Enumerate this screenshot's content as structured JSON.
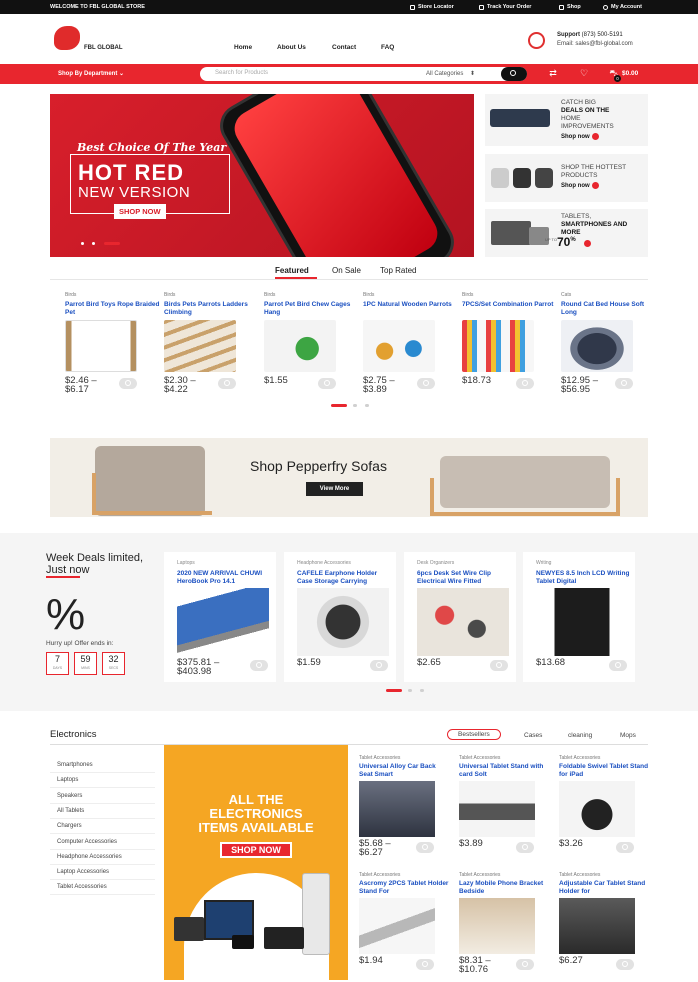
{
  "topbar": {
    "welcome": "WELCOME TO FBL GLOBAL STORE",
    "links": [
      "Store Locator",
      "Track Your Order",
      "Shop",
      "My Account"
    ]
  },
  "header": {
    "logo_text": "FBL GLOBAL",
    "nav": [
      "Home",
      "About Us",
      "Contact",
      "FAQ"
    ],
    "support_label": "Support",
    "support_phone": "(873) 500-5191",
    "support_email": "Email: sales@fbl-global.com"
  },
  "redbar": {
    "department": "Shop By Department",
    "search_placeholder": "Search for Products",
    "search_category": "All Categories",
    "cart_total": "$0.00",
    "cart_count": "0"
  },
  "hero": {
    "tagline": "Best Choice Of The Year",
    "headline": "HOT RED",
    "subheadline": "NEW VERSION",
    "cta": "SHOP NOW"
  },
  "promos": [
    {
      "lines": [
        "CATCH BIG",
        "DEALS ON THE",
        "HOME",
        "IMPROVEMENTS"
      ],
      "bold_line": 1,
      "cta": "Shop now"
    },
    {
      "lines": [
        "SHOP THE HOTTEST",
        "PRODUCTS"
      ],
      "cta": "Shop now"
    },
    {
      "lines": [
        "TABLETS,",
        "SMARTPHONES AND",
        "MORE"
      ],
      "upto": "UP TO",
      "pct": "70",
      "pct_sign": "%"
    }
  ],
  "tabs": [
    "Featured",
    "On Sale",
    "Top Rated"
  ],
  "featured_products": [
    {
      "cat": "Birds",
      "title": "Parrot Bird Toys Rope Braided Pet",
      "price": "$2.46 –",
      "price2": "$6.17"
    },
    {
      "cat": "Birds",
      "title": "Birds Pets Parrots Ladders Climbing",
      "price": "$2.30 –",
      "price2": "$4.22"
    },
    {
      "cat": "Birds",
      "title": "Parrot Pet Bird Chew Cages Hang",
      "price": "$1.55",
      "price2": ""
    },
    {
      "cat": "Birds",
      "title": "1PC Natural Wooden Parrots",
      "price": "$2.75 –",
      "price2": "$3.89"
    },
    {
      "cat": "Birds",
      "title": "7PCS/Set Combination Parrot",
      "price": "$18.73",
      "price2": ""
    },
    {
      "cat": "Cats",
      "title": "Round Cat Bed House Soft Long",
      "price": "$12.95 –",
      "price2": "$56.95"
    }
  ],
  "banner": {
    "headline": "Shop Pepperfry Sofas",
    "cta": "View More"
  },
  "week_deals": {
    "title_line1": "Week Deals limited,",
    "title_line2": "Just now",
    "percent": "%",
    "hurry": "Hurry up! Offer ends in:",
    "countdown": [
      {
        "value": "7",
        "label": "DAYS"
      },
      {
        "value": "59",
        "label": "MINS"
      },
      {
        "value": "32",
        "label": "SECS"
      }
    ],
    "products": [
      {
        "cat": "Laptops",
        "title": "2020 NEW ARRIVAL CHUWI HeroBook Pro 14.1",
        "price": "$375.81 –",
        "price2": "$403.98"
      },
      {
        "cat": "Headphone Accessories",
        "title": "CAFELE Earphone Holder Case Storage Carrying",
        "price": "$1.59",
        "price2": ""
      },
      {
        "cat": "Desk Organizers",
        "title": "6pcs Desk Set Wire Clip Electrical Wire Fitted",
        "price": "$2.65",
        "price2": ""
      },
      {
        "cat": "Writing",
        "title": "NEWYES 8.5 Inch LCD Writing Tablet Digital",
        "price": "$13.68",
        "price2": ""
      }
    ]
  },
  "electronics": {
    "title": "Electronics",
    "tabs": [
      "Bestsellers",
      "Cases",
      "cleaning",
      "Mops"
    ],
    "sidebar": [
      "Smartphones",
      "Laptops",
      "Speakers",
      "All Tablets",
      "Chargers",
      "Computer Accessories",
      "Headphone Accessories",
      "Laptop Accessories",
      "Tablet Accessories"
    ],
    "banner_line1": "ALL THE",
    "banner_line2": "ELECTRONICS",
    "banner_line3": "ITEMS AVAILABLE",
    "banner_cta": "SHOP NOW",
    "products": [
      {
        "cat": "Tablet Accessories",
        "title": "Universal Alloy Car Back Seat Smart",
        "price": "$5.68 –",
        "price2": "$6.27"
      },
      {
        "cat": "Tablet Accessories",
        "title": "Universal Tablet Stand with card Solt",
        "price": "$3.89",
        "price2": ""
      },
      {
        "cat": "Tablet Accessories",
        "title": "Foldable Swivel Tablet Stand for iPad",
        "price": "$3.26",
        "price2": ""
      },
      {
        "cat": "Tablet Accessories",
        "title": "Ascromy 2PCS Tablet Holder Stand For",
        "price": "$1.94",
        "price2": ""
      },
      {
        "cat": "Tablet Accessories",
        "title": "Lazy Mobile Phone Bracket Bedside",
        "price": "$8.31 –",
        "price2": "$10.76"
      },
      {
        "cat": "Tablet Accessories",
        "title": "Adjustable Car Tablet Stand Holder for",
        "price": "$6.27",
        "price2": ""
      }
    ]
  },
  "colors": {
    "accent": "#e8262e",
    "link": "#1a4fc0",
    "banner_orange": "#f5a623"
  }
}
